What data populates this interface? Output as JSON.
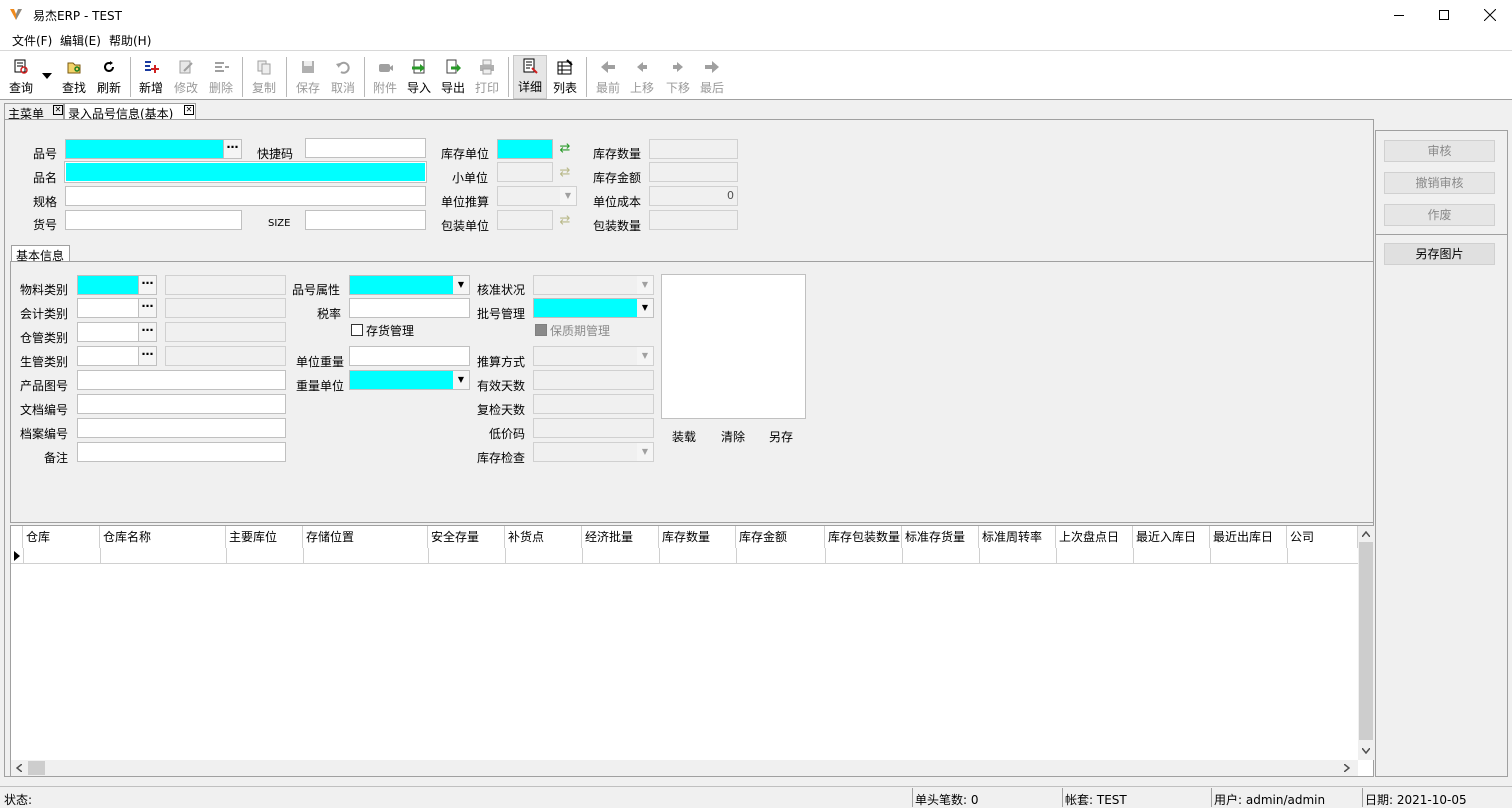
{
  "window": {
    "title": "易杰ERP - TEST"
  },
  "menu": [
    "文件(F)",
    "编辑(E)",
    "帮助(H)"
  ],
  "toolbar": {
    "query": "查询",
    "find": "查找",
    "refresh": "刷新",
    "new": "新增",
    "edit": "修改",
    "delete": "删除",
    "copy": "复制",
    "save": "保存",
    "cancel": "取消",
    "attach": "附件",
    "import": "导入",
    "export": "导出",
    "print": "打印",
    "detail": "详细",
    "list": "列表",
    "first": "最前",
    "prev": "上移",
    "next": "下移",
    "last": "最后"
  },
  "tabs": [
    "主菜单",
    "录入品号信息(基本)"
  ],
  "header": {
    "item_no": "品号",
    "shortcut": "快捷码",
    "item_name": "品名",
    "spec": "规格",
    "goods_no": "货号",
    "size": "SIZE",
    "stock_unit": "库存单位",
    "small_unit": "小单位",
    "unit_calc": "单位推算",
    "pack_unit": "包装单位",
    "stock_qty": "库存数量",
    "stock_amount": "库存金额",
    "unit_cost": "单位成本",
    "unit_cost_value": "0",
    "pack_qty": "包装数量"
  },
  "basic": {
    "section_tab": "基本信息",
    "material_cat": "物料类别",
    "account_cat": "会计类别",
    "warehouse_cat": "仓管类别",
    "production_cat": "生管类别",
    "product_drawing": "产品图号",
    "doc_no": "文档编号",
    "archive_no": "档案编号",
    "remark": "备注",
    "item_attr": "品号属性",
    "tax_rate": "税率",
    "inventory_mgmt": "存货管理",
    "unit_weight": "单位重量",
    "weight_unit": "重量单位",
    "approval_status": "核准状况",
    "batch_mgmt": "批号管理",
    "shelf_life_mgmt": "保质期管理",
    "calc_method": "推算方式",
    "valid_days": "有效天数",
    "recheck_days": "复检天数",
    "low_price": "低价码",
    "stock_check": "库存检查",
    "image_load": "装载",
    "image_clear": "清除",
    "image_save": "另存"
  },
  "grid": {
    "columns": [
      "仓库",
      "仓库名称",
      "主要库位",
      "存储位置",
      "安全存量",
      "补货点",
      "经济批量",
      "库存数量",
      "库存金额",
      "库存包装数量",
      "标准存货量",
      "标准周转率",
      "上次盘点日",
      "最近入库日",
      "最近出库日",
      "公司"
    ]
  },
  "side": {
    "approve": "审核",
    "unapprove": "撤销审核",
    "void": "作废",
    "save_image": "另存图片"
  },
  "status": {
    "state": "状态:",
    "count": "单头笔数: 0",
    "account": "帐套: TEST",
    "user": "用户: admin/admin",
    "date": "日期: 2021-10-05"
  },
  "colors": {
    "required": "#00ffff",
    "accent": "#2a9a2a"
  }
}
